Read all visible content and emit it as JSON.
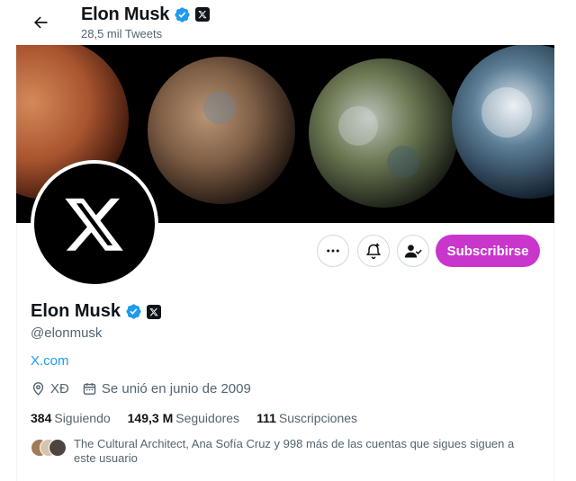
{
  "header": {
    "name": "Elon Musk",
    "tweet_count": "28,5 mil Tweets"
  },
  "profile": {
    "name": "Elon Musk",
    "handle": "@elonmusk",
    "website": "X.com",
    "location": "XĐ",
    "joined": "Se unió en junio de 2009"
  },
  "actions": {
    "subscribe_label": "Subscribirse"
  },
  "stats": {
    "following_count": "384",
    "following_label": "Siguiendo",
    "followers_count": "149,3 M",
    "followers_label": "Seguidores",
    "subscriptions_count": "111",
    "subscriptions_label": "Suscripciones"
  },
  "known_followers": {
    "text": "The Cultural Architect, Ana Sofía Cruz y 998 más de las cuentas que sigues siguen a este usuario"
  },
  "colors": {
    "verified": "#1d9bf0",
    "subscribe": "#c936cc",
    "link": "#1d9bf0"
  }
}
